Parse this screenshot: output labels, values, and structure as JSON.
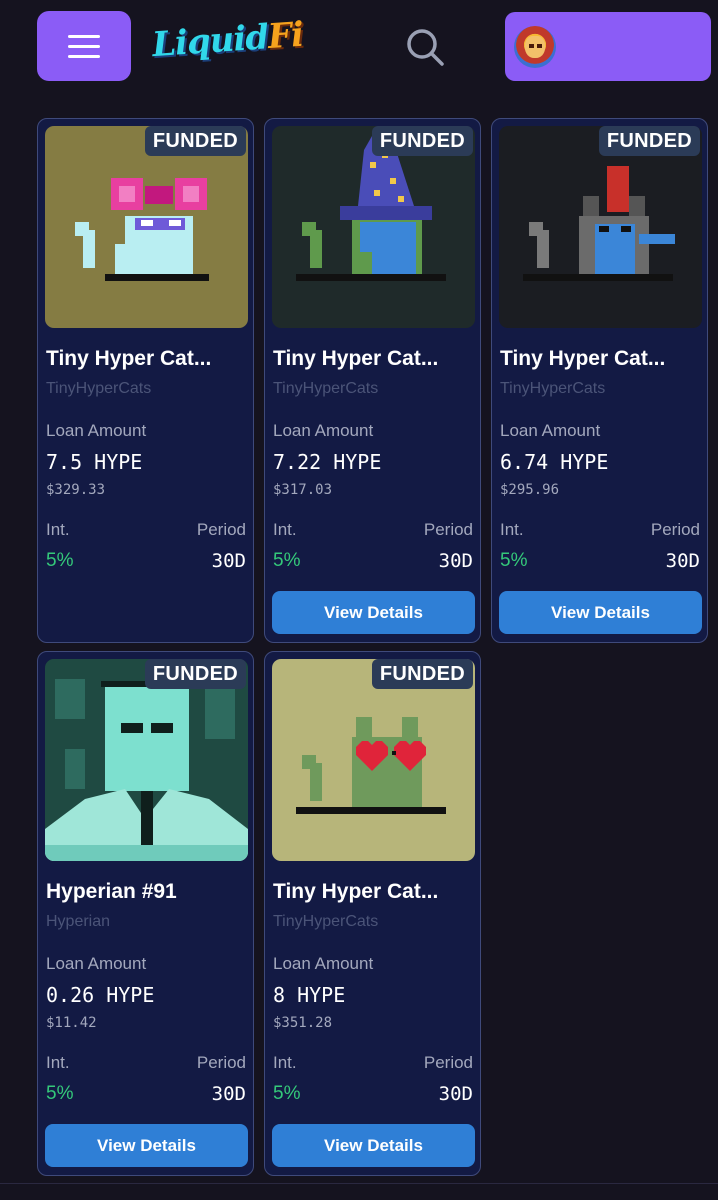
{
  "header": {
    "menu_icon": "hamburger-icon",
    "logo": {
      "part1": "Liquid",
      "part2": "Fi"
    },
    "search_icon": "search-icon",
    "wallet_avatar": "avatar-icon"
  },
  "colors": {
    "page_bg": "#15131f",
    "accent_purple": "#8b5cf6",
    "card_bg": "#131a44",
    "card_border": "#3f4a7b",
    "button_blue": "#2f7fd6",
    "interest_green": "#34c97a",
    "muted_text": "#a3a8bd",
    "badge_bg": "#2b3b57"
  },
  "labels": {
    "loan_amount": "Loan Amount",
    "interest": "Int.",
    "period": "Period",
    "view_details": "View Details"
  },
  "cards": [
    {
      "status": "FUNDED",
      "title": "Tiny Hyper Cat...",
      "collection": "TinyHyperCats",
      "loan": "7.5 HYPE",
      "usd": "$329.33",
      "interest": "5%",
      "period": "30D",
      "has_button": false,
      "image": "cat-with-pink-bow"
    },
    {
      "status": "FUNDED",
      "title": "Tiny Hyper Cat...",
      "collection": "TinyHyperCats",
      "loan": "7.22 HYPE",
      "usd": "$317.03",
      "interest": "5%",
      "period": "30D",
      "has_button": true,
      "image": "cat-with-wizard-hat"
    },
    {
      "status": "FUNDED",
      "title": "Tiny Hyper Cat...",
      "collection": "TinyHyperCats",
      "loan": "6.74 HYPE",
      "usd": "$295.96",
      "interest": "5%",
      "period": "30D",
      "has_button": true,
      "image": "cat-with-red-mohawk"
    },
    {
      "status": "FUNDED",
      "title": "Hyperian #91",
      "collection": "Hyperian",
      "loan": "0.26 HYPE",
      "usd": "$11.42",
      "interest": "5%",
      "period": "30D",
      "has_button": true,
      "image": "hyperian-figure"
    },
    {
      "status": "FUNDED",
      "title": "Tiny Hyper Cat...",
      "collection": "TinyHyperCats",
      "loan": "8 HYPE",
      "usd": "$351.28",
      "interest": "5%",
      "period": "30D",
      "has_button": true,
      "image": "cat-with-heart-glasses"
    }
  ]
}
